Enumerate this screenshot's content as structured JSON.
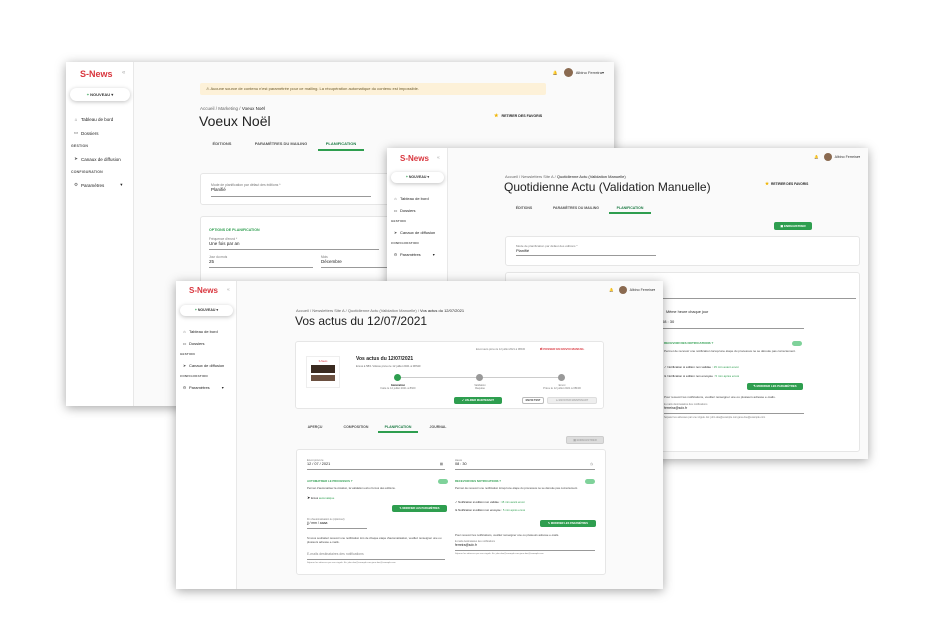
{
  "app": {
    "logo": "S-News",
    "collapse": "«",
    "new_button": "NOUVEAU",
    "user": "Albino Ferreira"
  },
  "nav": {
    "dashboard": "Tableau de bord",
    "folders": "Dossiers",
    "section_gestion": "GESTION",
    "channels": "Canaux de diffusion",
    "section_config": "CONFIGURATION",
    "settings": "Paramètres"
  },
  "win1": {
    "warning": "Aucune source de contenu n'est paramétrée pour ce mailing. La récupération automatique du contenu est impossible.",
    "crumb": [
      "Accueil",
      "Marketing",
      "Voeux Noël"
    ],
    "title": "Voeux Noël",
    "fav": "RETIRER DES FAVORIS",
    "tabs": [
      "ÉDITIONS",
      "PARAMÈTRES DU MAILING",
      "PLANIFICATION"
    ],
    "plan_label": "Mode de planification par défaut des éditions *",
    "plan_value": "Planifié",
    "options_title": "OPTIONS DE PLANIFICATION",
    "freq_label": "Fréquence d'envoi *",
    "freq_value": "Une fois par an",
    "day_label": "Jour du mois",
    "day_value": "25",
    "month_label": "Mois",
    "month_value": "Décembre"
  },
  "win2": {
    "crumb": [
      "Accueil",
      "Newsletters Site A",
      "Quotidienne Actu (Validation Manuelle)"
    ],
    "title": "Quotidienne Actu (Validation Manuelle)",
    "fav": "RETIRER DES FAVORIS",
    "tabs": [
      "ÉDITIONS",
      "PARAMÈTRES DU MAILING",
      "PLANIFICATION"
    ],
    "save": "ENREGISTRER",
    "plan_label": "Mode de planification par défaut des éditions *",
    "plan_value": "Planifié",
    "same_hour": "Même heure chaque jour",
    "time": "08 : 30",
    "notif_title": "RECEVOIR DES NOTIFICATIONS ?",
    "notif_desc": "Permet de recevoir une notification lorsqu'une étape du processus ne se déroule pas correctement.",
    "notif_1": "Notification si édition non validée :",
    "notif_1_link": "15 min avant envoi",
    "notif_2": "Notification si édition non envoyée :",
    "notif_2_link": "5 min après envoi",
    "modify": "MODIFIER LES PARAMÈTRES",
    "recv_text": "Pour recevoir les notifications, veuillez renseigner une ou plusieurs adresse e-mails.",
    "email_label": "E-mails destinataires des notifications",
    "email_value": "ferreira@sdx.fr",
    "email_help": "Séparer les adresses par une virgule. Ex: john.doe@example.com,jane.doe@example.com"
  },
  "win3": {
    "crumb": [
      "Accueil",
      "Newsletters Site A",
      "Quotidienne Actu (Validation Manuelle)",
      "Vos actus du 12/07/2021"
    ],
    "title": "Vos actus du 12/07/2021",
    "planned": "Envoi auto prévu le 12 juillet 2021 à 08h30",
    "pass_manual": "PASSER EN ENVOI MANUEL",
    "edition_title": "Vos actus du 12/07/2021",
    "edition_sub": "Envoi à 58/1 Vidéos prévu le 12 juillet 2021 à 08h30",
    "thumb_logo": "S-News",
    "steps": [
      {
        "label": "Génération",
        "sub": "Faite le 12 juillet 2021 à 8h00"
      },
      {
        "label": "Validation",
        "sub": "Requise"
      },
      {
        "label": "Envoi",
        "sub": "Prévu le 12 juillet 2021 à 08h30"
      }
    ],
    "validate": "VALIDER MAINTENANT",
    "test": "ENVOI TEST",
    "send_now": "ENVOYER MAINTENANT",
    "tabs": [
      "APERÇU",
      "COMPOSITION",
      "PLANIFICATION",
      "JOURNAL"
    ],
    "save": "ENREGISTRER",
    "date_label": "Envoi prévu le",
    "date_value": "12 / 07 / 2021",
    "hour_label": "Heure",
    "hour_value": "08 : 30",
    "auto_title": "AUTOMATISER LE PROCESSUS ?",
    "auto_desc": "Permet d'automatiser la création, la validation et/ou l'envoi des éditions.",
    "auto_item": "Envoi",
    "auto_item_link": "automatique",
    "modify": "MODIFIER LES PARAMÈTRES",
    "deadline_label": "Fin d'automatisation le (optionnel)",
    "deadline_value": "jj / mm / aaaa",
    "deadline_text": "Si vous souhaitez recevoir une notification lors de chaque étape d'automatisation, veuillez renseigner une ou plusieurs adresse e-mails.",
    "email_placeholder": "E-mails destinataires des notifications",
    "email_help": "Séparer les adresses par une virgule. Ex: john.doe@example.com,jane.doe@example.com",
    "notif_title": "RECEVOIR DES NOTIFICATIONS ?",
    "notif_desc": "Permet de recevoir une notification lorsqu'une étape du processus ne se déroule pas correctement.",
    "notif_1": "Notification si édition non validée :",
    "notif_1_link": "15 min avant envoi",
    "notif_2": "Notification si édition non envoyée :",
    "notif_2_link": "5 min après envoi",
    "recv_text": "Pour recevoir les notifications, veuillez renseigner une ou plusieurs adresse e-mails.",
    "email_label": "E-mails destinataires des notifications",
    "email_value": "ferreira@sdx.fr",
    "email_help2": "Séparer les adresses par une virgule. Ex: john.doe@example.com,jane.doe@example.com"
  },
  "colors": {
    "brand": "#d9363e",
    "accent": "#2e9e4f",
    "warning": "#fdf1d8"
  }
}
